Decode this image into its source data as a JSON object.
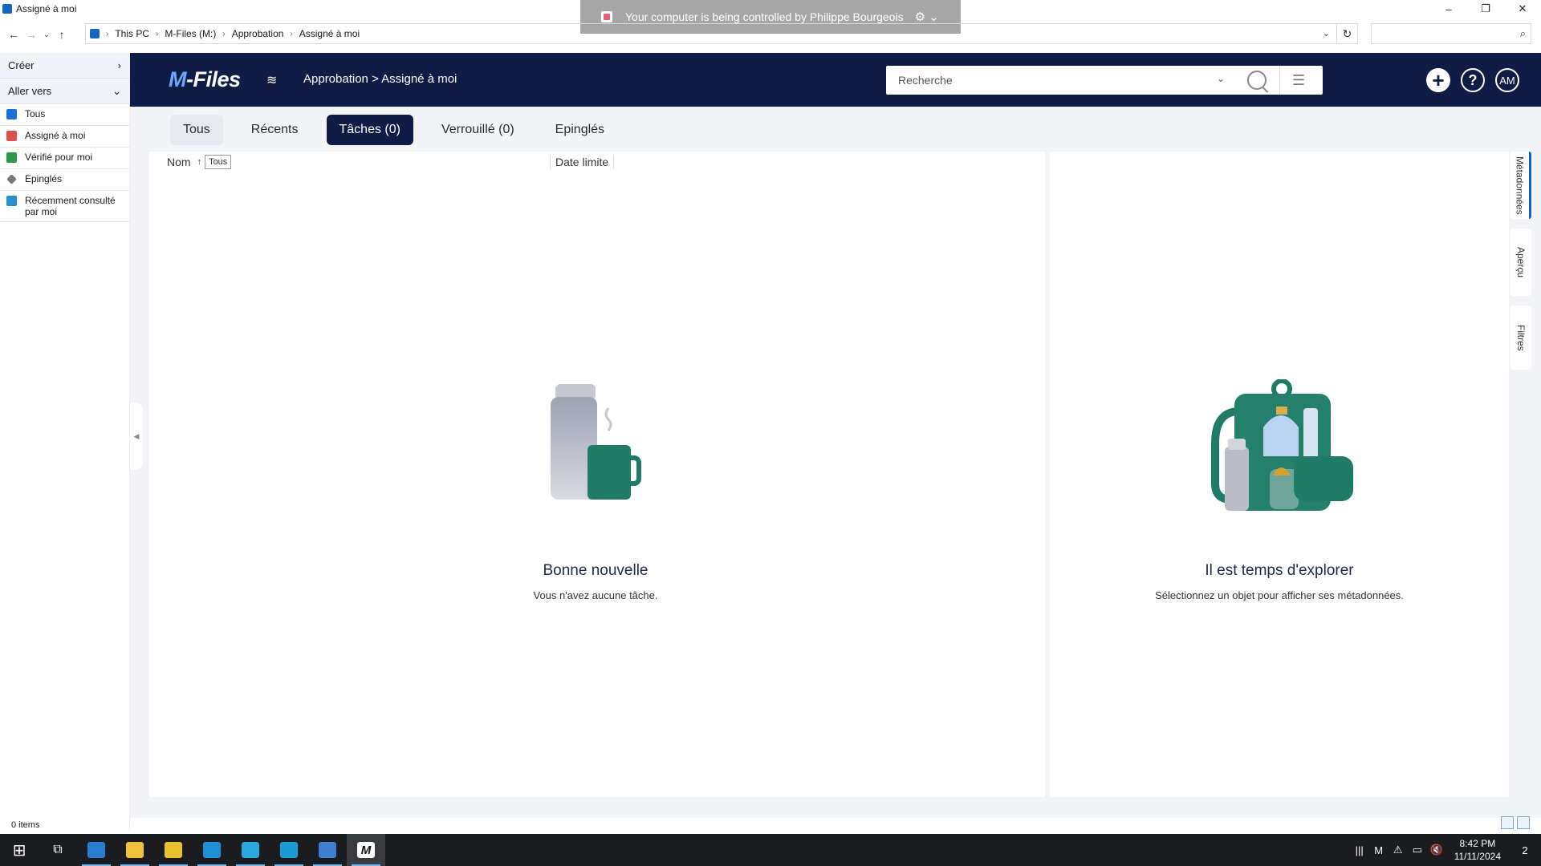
{
  "window": {
    "title": "Assigné à moi",
    "controls": [
      "–",
      "❐",
      "✕"
    ]
  },
  "remote_banner": {
    "text": "Your computer is being controlled by Philippe Bourgeois",
    "gear": "⚙ ⌄"
  },
  "address": {
    "crumbs": [
      "This PC",
      "M-Files (M:)",
      "Approbation",
      "Assigné à moi"
    ],
    "separator": "›",
    "dropdown": "⌄",
    "refresh": "↻",
    "search_icon": "⌕",
    "nav": {
      "back": "←",
      "forward": "→",
      "recent": "⌄",
      "up": "↑"
    }
  },
  "left_pane": {
    "creer": "Créer",
    "creer_arrow": "›",
    "aller_vers": "Aller vers",
    "aller_arrow": "⌄",
    "items": [
      {
        "label": "Tous",
        "color": "#1e6fd9"
      },
      {
        "label": "Assigné à moi",
        "color": "#d9534f"
      },
      {
        "label": "Vérifié pour moi",
        "color": "#2e9a4a"
      },
      {
        "label": "Epinglés",
        "color": "#777777"
      },
      {
        "label": "Récemment consulté par moi",
        "color": "#2a8fd1"
      }
    ],
    "status": "0 items"
  },
  "header": {
    "logo_m": "M",
    "logo_rest": "-Files",
    "wifi": "≋",
    "breadcrumb": "Approbation > Assigné à moi",
    "search_placeholder": "Recherche",
    "search_dropdown": "⌄",
    "search_options": "☰",
    "add": "+",
    "help": "?",
    "avatar": "AM"
  },
  "tabs": [
    {
      "label": "Tous"
    },
    {
      "label": "Récents"
    },
    {
      "label": "Tâches (0)"
    },
    {
      "label": "Verrouillé (0)"
    },
    {
      "label": "Epinglés"
    }
  ],
  "list": {
    "col_name": "Nom",
    "sort_arrow": "↑",
    "filter": "Tous",
    "col_deadline": "Date limite",
    "empty_title": "Bonne nouvelle",
    "empty_sub": "Vous n'avez aucune tâche.",
    "collapse": "◀"
  },
  "metadata": {
    "empty_title": "Il est temps d'explorer",
    "empty_sub": "Sélectionnez un objet pour afficher ses métadonnées.",
    "side_tabs": [
      "Métadonnées",
      "Aperçu",
      "Filtres"
    ]
  },
  "colors": {
    "header_bg": "#0f1c45",
    "accent": "#0c60d8",
    "teal": "#1f7a66"
  },
  "taskbar": {
    "start": "⊞",
    "taskview": "⧉",
    "apps": [
      {
        "name": "file-manager",
        "color": "#2b7cd3"
      },
      {
        "name": "explorer",
        "color": "#f0c23a"
      },
      {
        "name": "app-tool",
        "color": "#e7c22c"
      },
      {
        "name": "app-blue",
        "color": "#1d8fd6"
      },
      {
        "name": "app-v",
        "color": "#29a7e1"
      },
      {
        "name": "app-s",
        "color": "#1a9ad6"
      },
      {
        "name": "admin-tool",
        "color": "#3c7fd1"
      },
      {
        "name": "m-files",
        "color": "#111111"
      }
    ],
    "tray": [
      "|||",
      "M",
      "⚠",
      "▭",
      "🔇"
    ],
    "time": "8:42 PM",
    "date": "11/11/2024",
    "notifications": "2"
  }
}
